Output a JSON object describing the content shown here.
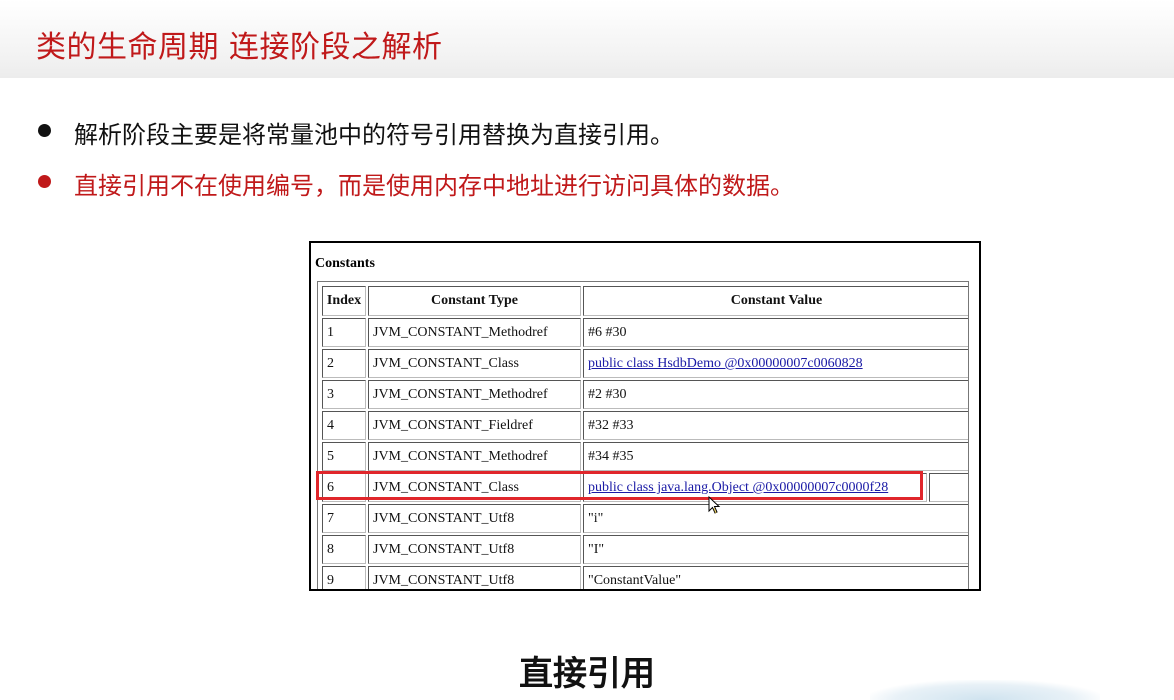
{
  "slide": {
    "title": "类的生命周期 连接阶段之解析",
    "bullets": [
      "解析阶段主要是将常量池中的符号引用替换为直接引用。",
      "直接引用不在使用编号，而是使用内存中地址进行访问具体的数据。"
    ],
    "footer_label": "直接引用"
  },
  "table": {
    "title": "Constants",
    "headers": [
      "Index",
      "Constant Type",
      "Constant Value"
    ],
    "rows": [
      {
        "index": "1",
        "type": "JVM_CONSTANT_Methodref",
        "value": "#6 #30"
      },
      {
        "index": "2",
        "type": "JVM_CONSTANT_Class",
        "value": "public class HsdbDemo @0x00000007c0060828"
      },
      {
        "index": "3",
        "type": "JVM_CONSTANT_Methodref",
        "value": "#2 #30"
      },
      {
        "index": "4",
        "type": "JVM_CONSTANT_Fieldref",
        "value": "#32 #33"
      },
      {
        "index": "5",
        "type": "JVM_CONSTANT_Methodref",
        "value": "#34 #35"
      },
      {
        "index": "6",
        "type": "JVM_CONSTANT_Class",
        "value": "public class java.lang.Object @0x00000007c0000f28"
      },
      {
        "index": "7",
        "type": "JVM_CONSTANT_Utf8",
        "value": "\"i\""
      },
      {
        "index": "8",
        "type": "JVM_CONSTANT_Utf8",
        "value": "\"I\""
      },
      {
        "index": "9",
        "type": "JVM_CONSTANT_Utf8",
        "value": "\"ConstantValue\""
      }
    ],
    "highlighted_row_index": "6"
  },
  "colors": {
    "accent_red": "#c0191a",
    "highlight_border": "#e0262b",
    "link_blue": "#1a1aa6"
  }
}
